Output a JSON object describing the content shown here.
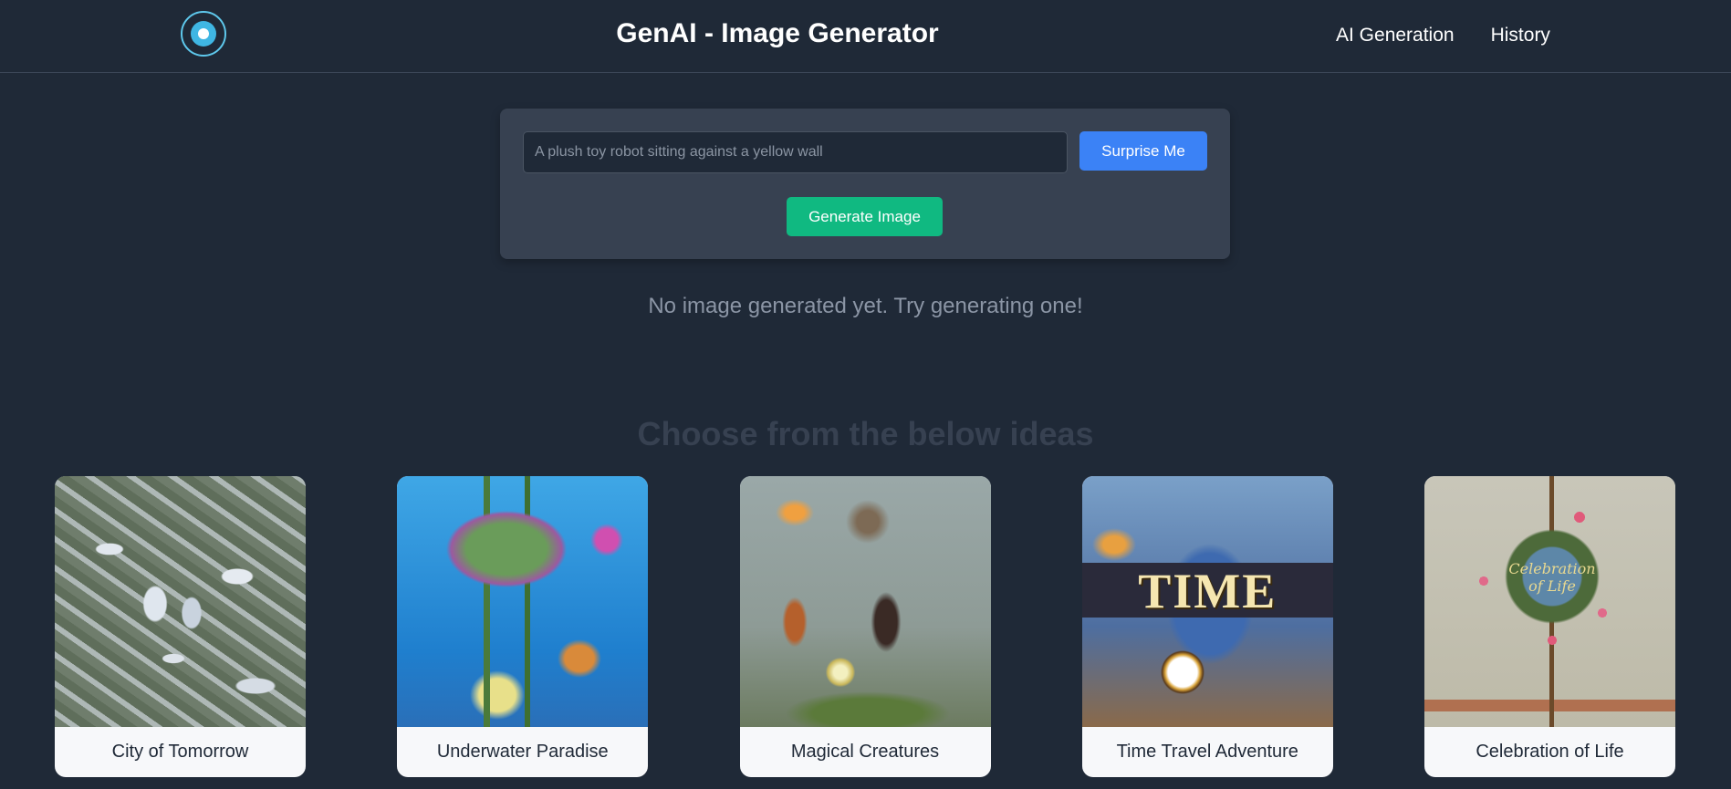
{
  "app": {
    "title": "GenAI - Image Generator",
    "logo_icon": "aperture-icon"
  },
  "nav": {
    "items": [
      {
        "label": "AI Generation"
      },
      {
        "label": "History"
      }
    ]
  },
  "generator": {
    "prompt_value": "",
    "prompt_placeholder": "A plush toy robot sitting against a yellow wall",
    "surprise_label": "Surprise Me",
    "generate_label": "Generate Image"
  },
  "empty_message": "No image generated yet. Try generating one!",
  "ideas": {
    "heading": "Choose from the below ideas",
    "cards": [
      {
        "caption": "City of Tomorrow"
      },
      {
        "caption": "Underwater Paradise"
      },
      {
        "caption": "Magical Creatures"
      },
      {
        "caption": "Time Travel Adventure",
        "image_text": "TIME"
      },
      {
        "caption": "Celebration of Life",
        "image_text": "Celebration of Life"
      }
    ]
  },
  "colors": {
    "background": "#1f2937",
    "panel": "#374151",
    "surprise_button": "#3b82f6",
    "generate_button": "#10b981"
  }
}
